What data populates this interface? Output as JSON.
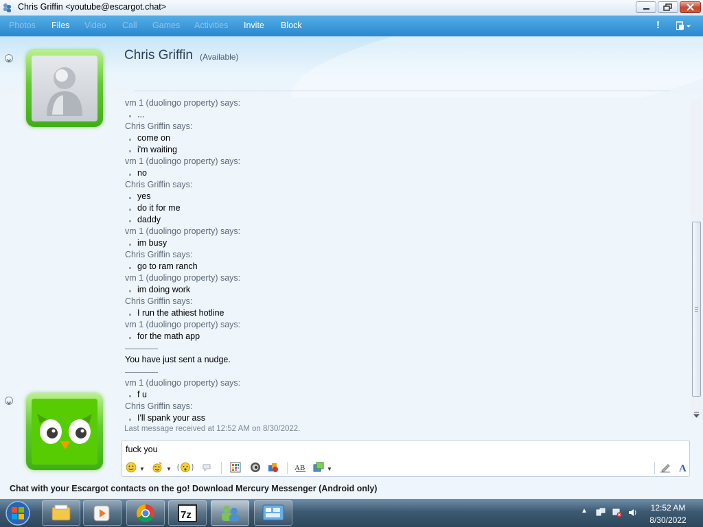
{
  "window": {
    "title": "Chris Griffin <youtube@escargot.chat>"
  },
  "toolbar": {
    "items": [
      {
        "label": "Photos",
        "enabled": false
      },
      {
        "label": "Files",
        "enabled": true
      },
      {
        "label": "Video",
        "enabled": false
      },
      {
        "label": "Call",
        "enabled": false
      },
      {
        "label": "Games",
        "enabled": false
      },
      {
        "label": "Activities",
        "enabled": false
      },
      {
        "label": "Invite",
        "enabled": true
      },
      {
        "label": "Block",
        "enabled": true
      }
    ],
    "alert_symbol": "!"
  },
  "contact": {
    "name": "Chris Griffin",
    "status": "(Available)"
  },
  "conversation": {
    "lines": [
      {
        "kind": "says",
        "text": "vm 1 (duolingo property) says:"
      },
      {
        "kind": "msg",
        "text": "..."
      },
      {
        "kind": "says",
        "text": "Chris Griffin says:"
      },
      {
        "kind": "msg",
        "text": "come on"
      },
      {
        "kind": "msg",
        "text": "i'm waiting"
      },
      {
        "kind": "says",
        "text": "vm 1 (duolingo property) says:"
      },
      {
        "kind": "msg",
        "text": "no"
      },
      {
        "kind": "says",
        "text": "Chris Griffin says:"
      },
      {
        "kind": "msg",
        "text": "yes"
      },
      {
        "kind": "msg",
        "text": "do it for me"
      },
      {
        "kind": "msg",
        "text": "daddy"
      },
      {
        "kind": "says",
        "text": "vm 1 (duolingo property) says:"
      },
      {
        "kind": "msg",
        "text": "im busy"
      },
      {
        "kind": "says",
        "text": "Chris Griffin says:"
      },
      {
        "kind": "msg",
        "text": "go to ram ranch"
      },
      {
        "kind": "says",
        "text": "vm 1 (duolingo property) says:"
      },
      {
        "kind": "msg",
        "text": "im doing work"
      },
      {
        "kind": "says",
        "text": "Chris Griffin says:"
      },
      {
        "kind": "msg",
        "text": "I run the athiest hotline"
      },
      {
        "kind": "says",
        "text": "vm 1 (duolingo property) says:"
      },
      {
        "kind": "msg",
        "text": "for the math app"
      },
      {
        "kind": "sep"
      },
      {
        "kind": "notice",
        "text": "You have just sent a nudge."
      },
      {
        "kind": "sep"
      },
      {
        "kind": "says",
        "text": "vm 1 (duolingo property) says:"
      },
      {
        "kind": "msg",
        "text": "f u"
      },
      {
        "kind": "says",
        "text": "Chris Griffin says:"
      },
      {
        "kind": "msg",
        "text": "I'll spank your ass"
      },
      {
        "kind": "last",
        "text": "Last message received at 12:52 AM on 8/30/2022."
      }
    ]
  },
  "input": {
    "value": "fuck you"
  },
  "format_toolbar": {
    "icons": [
      "emoticon-icon",
      "wink-icon",
      "nudge-icon",
      "voice-clip-icon",
      "background-icon",
      "sound-icon",
      "games-icon",
      "font-icon",
      "more-icon"
    ]
  },
  "ad": {
    "text": "Chat with your Escargot contacts on the go! Download Mercury Messenger (Android only)"
  },
  "taskbar": {
    "time": "12:52 AM",
    "date": "8/30/2022",
    "apps": [
      "explorer-icon",
      "media-player-icon",
      "chrome-icon",
      "7zip-icon",
      "messenger-icon",
      "control-panel-icon"
    ]
  },
  "colors": {
    "accent": "#2a87cf",
    "avatar_green": "#62c92f",
    "duo_green": "#58cc02"
  }
}
